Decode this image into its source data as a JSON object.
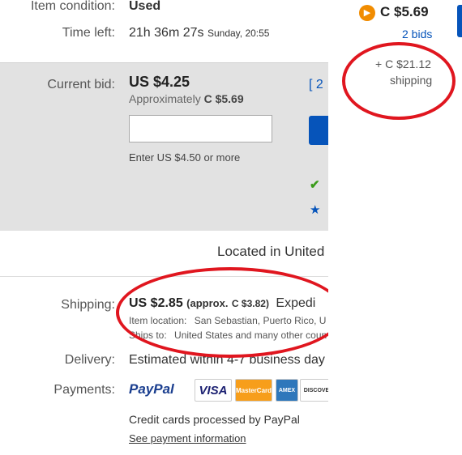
{
  "listing": {
    "item_condition_label": "Item condition:",
    "item_condition_value": "Used",
    "time_left_label": "Time left:",
    "time_left_value": "21h 36m 27s",
    "time_left_end": "Sunday, 20:55",
    "current_bid_label": "Current bid:",
    "current_bid_value": "US $4.25",
    "approx_prefix": "Approximately",
    "approx_value": "C $5.69",
    "bids_link": "[ 2",
    "bid_hint": "Enter US $4.50 or more",
    "located": "Located in United",
    "shipping_label": "Shipping:",
    "shipping_cost": "US $2.85",
    "shipping_approx_open": "(approx.",
    "shipping_approx_value": "C $3.82)",
    "shipping_method": "Expedi",
    "item_location_label": "Item location:",
    "item_location_value": "San Sebastian, Puerto Rico, U",
    "ships_to_label": "Ships to:",
    "ships_to_value": "United States and many other coun",
    "delivery_label": "Delivery:",
    "delivery_value": "Estimated within 4-7 business day",
    "payments_label": "Payments:",
    "paypal_logo": "PayPal",
    "cards": [
      "VISA",
      "MasterCard",
      "AMEX",
      "DISCOVER"
    ],
    "credit_note": "Credit cards processed by PayPal",
    "payment_info_link": "See payment information"
  },
  "sidebar": {
    "price": "C $5.69",
    "bids": "2 bids",
    "shipping_amount": "+ C $21.12",
    "shipping_word": "shipping"
  },
  "colors": {
    "accent": "#0654ba",
    "highlight": "#e0161f",
    "link": "#0654ba",
    "bid_badge": "#f18c00"
  },
  "icons": [
    "check-icon",
    "star-icon",
    "bid-badge-icon"
  ]
}
